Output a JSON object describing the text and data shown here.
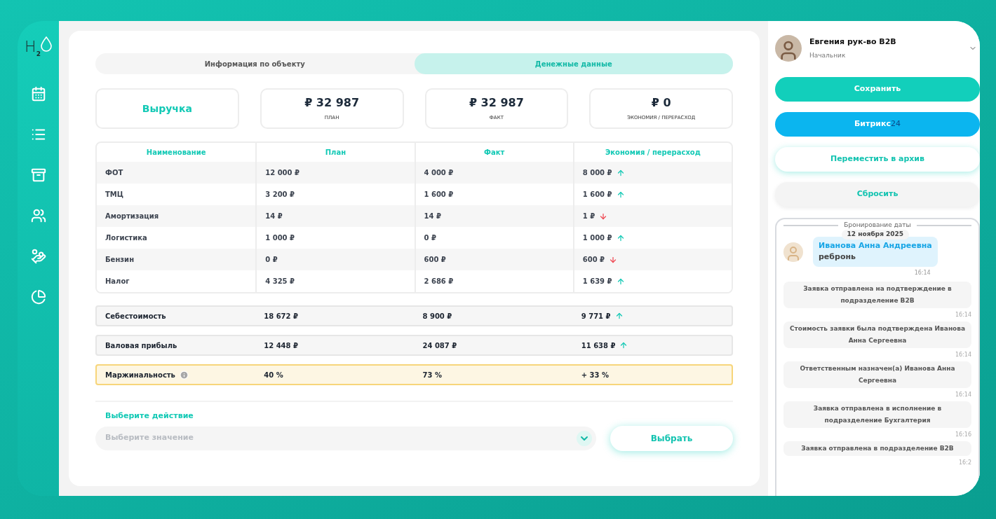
{
  "sidebar": {
    "logo": {
      "letter": "H",
      "sub": "2"
    },
    "items": [
      {
        "kind": "calendar",
        "selected": false
      },
      {
        "kind": "list",
        "selected": false
      },
      {
        "kind": "archive",
        "selected": false
      },
      {
        "kind": "users",
        "selected": false
      },
      {
        "kind": "money",
        "selected": false
      },
      {
        "kind": "chart",
        "selected": false
      }
    ]
  },
  "tabs": [
    {
      "label": "Информация по объекту",
      "selected": false
    },
    {
      "label": "Денежные данные",
      "selected": true
    }
  ],
  "summary_cards": [
    {
      "kind": "title",
      "value": "Выручка"
    },
    {
      "kind": "amount",
      "value": "₽ 32 987",
      "caption": "ПЛАН"
    },
    {
      "kind": "amount",
      "value": "₽ 32 987",
      "caption": "ФАКТ"
    },
    {
      "kind": "amount",
      "value": "₽ 0",
      "caption": "ЭКОНОМИЯ / ПЕРЕРАСХОД"
    }
  ],
  "table": {
    "columns": [
      "Наименование",
      "План",
      "Факт",
      "Экономия / перерасход"
    ],
    "rows": [
      {
        "name": "ФОТ",
        "plan": "12 000 ₽",
        "fact": "4 000 ₽",
        "diff": "8 000 ₽",
        "overspend": false
      },
      {
        "name": "ТМЦ",
        "plan": "3 200 ₽",
        "fact": "1 600 ₽",
        "diff": "1 600 ₽",
        "overspend": false
      },
      {
        "name": "Амортизация",
        "plan": "14 ₽",
        "fact": "14 ₽",
        "diff": "1 ₽",
        "overspend": true
      },
      {
        "name": "Логистика",
        "plan": "1 000 ₽",
        "fact": "0 ₽",
        "diff": "1 000 ₽",
        "overspend": false
      },
      {
        "name": "Бензин",
        "plan": "0 ₽",
        "fact": "600 ₽",
        "diff": "600 ₽",
        "overspend": true
      },
      {
        "name": "Налог",
        "plan": "4 325 ₽",
        "fact": "2 686 ₽",
        "diff": "1 639 ₽",
        "overspend": false
      }
    ]
  },
  "totals": [
    {
      "kind": "total",
      "name": "Себестоимость",
      "plan": "18 672 ₽",
      "fact": "8 900 ₽",
      "diff": "9 771 ₽",
      "arrow": true
    },
    {
      "kind": "total",
      "name": "Валовая прибыль",
      "plan": "12 448 ₽",
      "fact": "24 087 ₽",
      "diff": "11 638 ₽",
      "arrow": true
    },
    {
      "kind": "highlight",
      "name": "Маржинальность",
      "info": true,
      "plan": "40 %",
      "fact": "73 %",
      "diff": "+ 33 %",
      "arrow": false
    }
  ],
  "action": {
    "label": "Выберите действие",
    "select": {
      "placeholder": "Выберите значение"
    },
    "button": "Выбрать"
  },
  "profile": {
    "name": "Евгения рук-во B2B",
    "role": "Начальник"
  },
  "buttons": [
    {
      "kind": "primary",
      "label": "Сохранить"
    },
    {
      "kind": "bitrix",
      "label": "Битрикс",
      "suffix": "24"
    },
    {
      "kind": "outline",
      "label": "Переместить в архив"
    },
    {
      "kind": "muted",
      "label": "Сбросить"
    }
  ],
  "history": {
    "section": "Бронирование даты",
    "date": "12 ноября 2025",
    "message": {
      "author": "Иванова Анна Андреевна",
      "text": "ребронь",
      "time": "16:14"
    },
    "events": [
      {
        "text": "Заявка отправлена на подтверждение в подразделение B2B",
        "time": "16:14"
      },
      {
        "text": "Стоимость заявки была подтверждена Иванова Анна Сергеевна",
        "time": "16:14"
      },
      {
        "text": "Ответственным назначен(а) Иванова Анна Сергеевна",
        "time": "16:14"
      },
      {
        "text": "Заявка отправлена в исполнение в подразделение Бухгалтерия",
        "time": "16:16"
      },
      {
        "text": "Заявка отправлена в подразделение B2B",
        "time": "16:2"
      }
    ]
  }
}
